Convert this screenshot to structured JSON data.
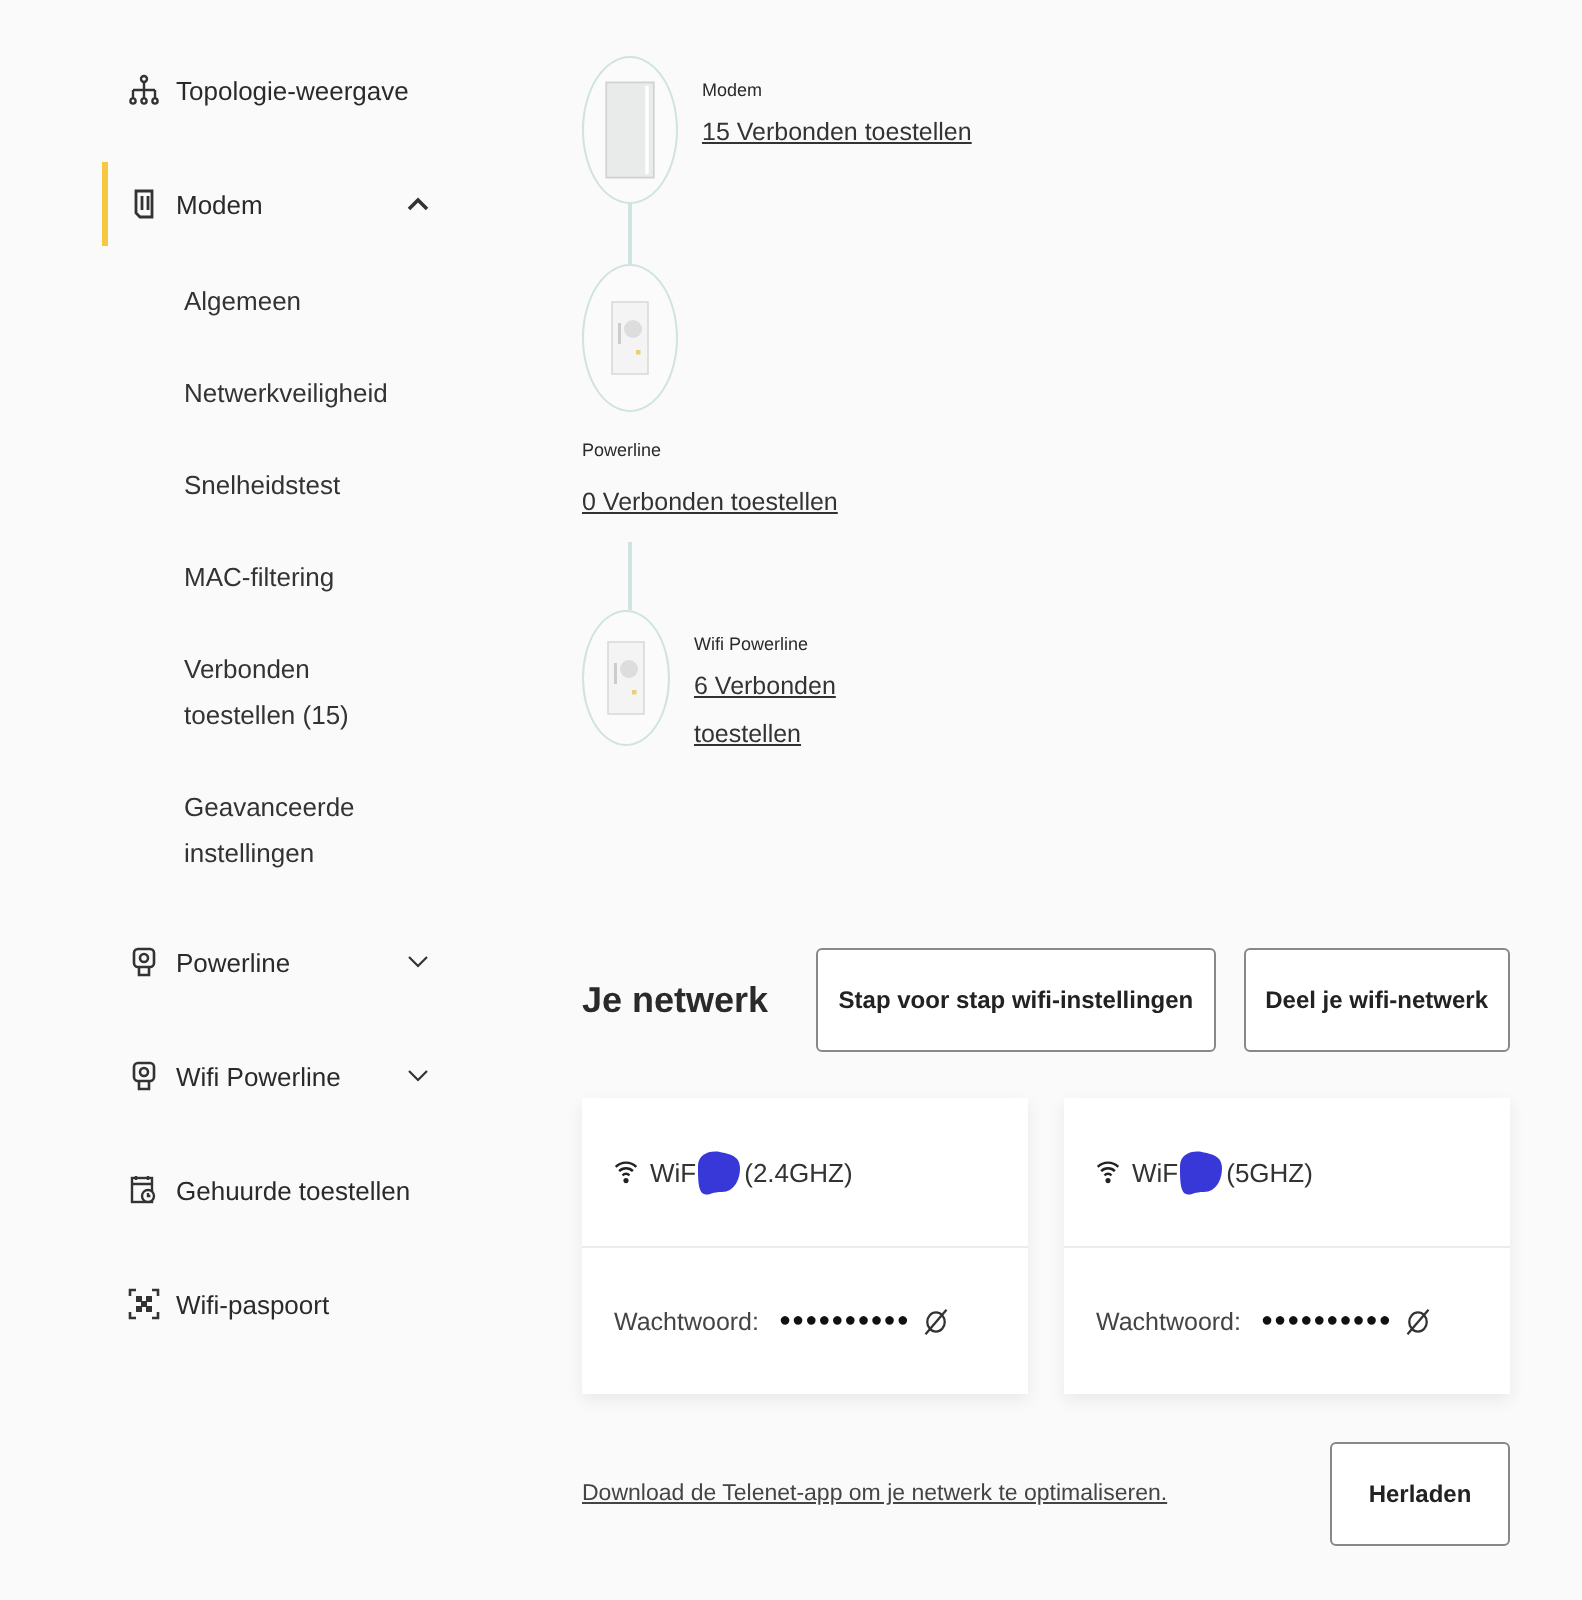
{
  "sidebar": {
    "items": [
      {
        "label": "Topologie-weergave",
        "kind": "topology",
        "selected": false
      },
      {
        "label": "Modem",
        "kind": "modem",
        "selected": true,
        "expanded": true,
        "children": [
          {
            "label": "Algemeen"
          },
          {
            "label": "Netwerkveiligheid"
          },
          {
            "label": "Snelheidstest"
          },
          {
            "label": "MAC-filtering"
          },
          {
            "label": "Verbonden toestellen (15)"
          },
          {
            "label": "Geavanceerde instellingen"
          }
        ]
      },
      {
        "label": "Powerline",
        "kind": "powerline",
        "selected": false,
        "expanded": false
      },
      {
        "label": "Wifi Powerline",
        "kind": "powerline",
        "selected": false,
        "expanded": false
      },
      {
        "label": "Gehuurde toestellen",
        "kind": "rented",
        "selected": false
      },
      {
        "label": "Wifi-paspoort",
        "kind": "passport",
        "selected": false
      }
    ]
  },
  "topology": {
    "nodes": [
      {
        "name": "Modem",
        "kind": "modem",
        "link": "15 Verbonden toestellen"
      },
      {
        "name": "Powerline",
        "kind": "powerline",
        "link": "0 Verbonden toestellen"
      },
      {
        "name": "Wifi Powerline",
        "kind": "powerline",
        "link": "6 Verbonden toestellen"
      }
    ]
  },
  "network": {
    "title": "Je netwerk",
    "buttons": [
      "Stap voor stap wifi-instellingen",
      "Deel je wifi-netwerk"
    ],
    "cards": [
      {
        "name_start": "WiF",
        "name_end": "(2.4GHZ)",
        "password_label": "Wachtwoord:",
        "password": "●●●●●●●●●●"
      },
      {
        "name_start": "WiF",
        "name_end": "(5GHZ)",
        "password_label": "Wachtwoord:",
        "password": "●●●●●●●●●●"
      }
    ],
    "footer_link": "Download de Telenet-app om je netwerk te optimaliseren.",
    "reload_button": "Herladen"
  }
}
